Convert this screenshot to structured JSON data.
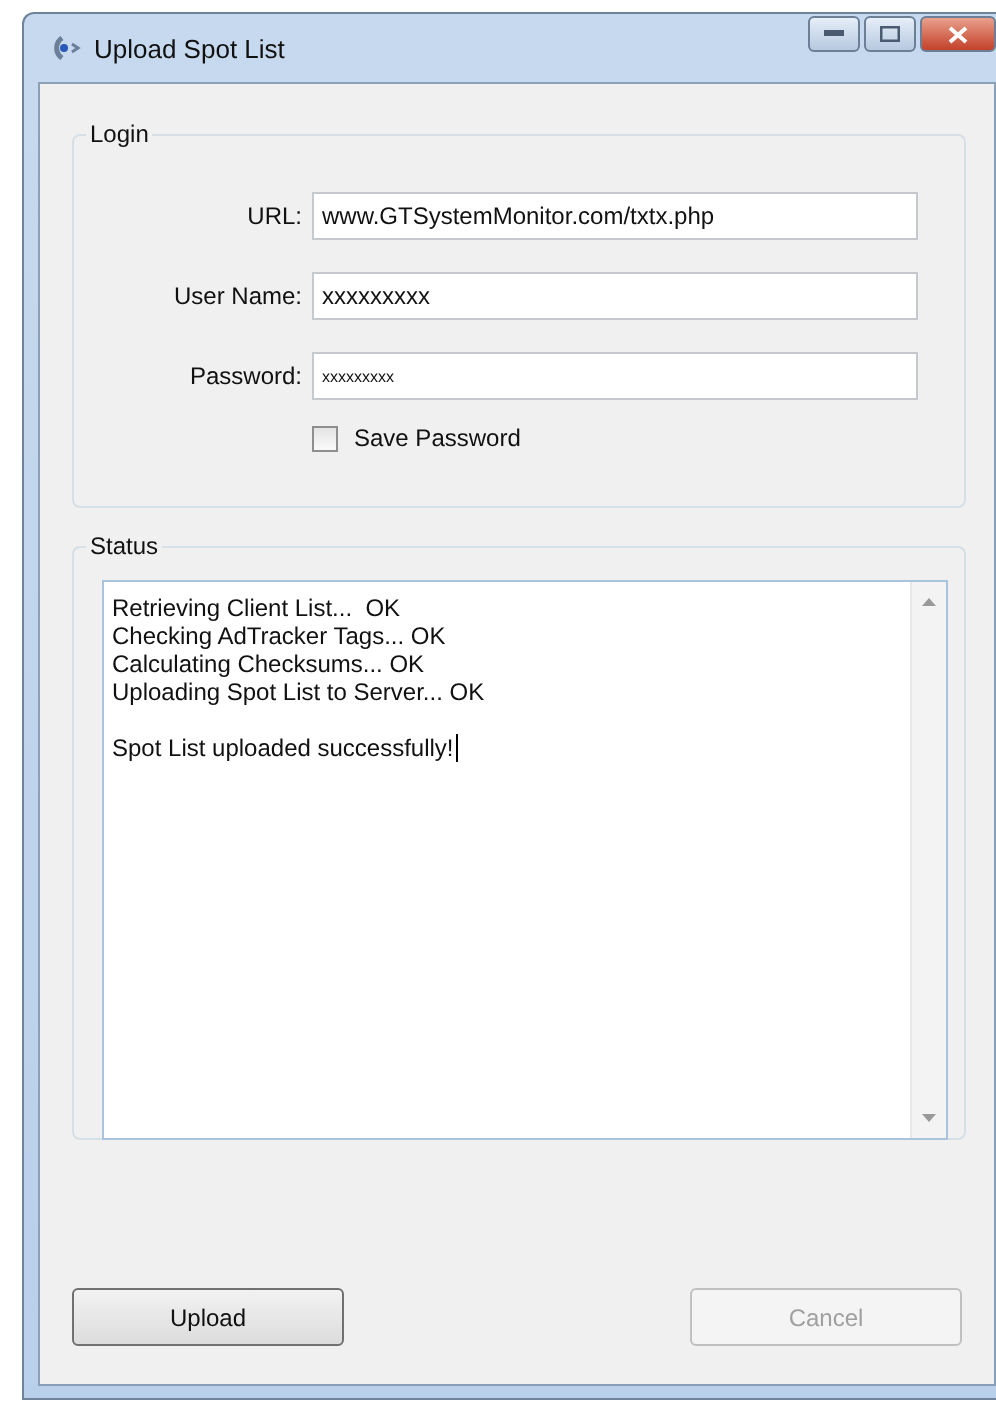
{
  "window": {
    "title": "Upload Spot List"
  },
  "login": {
    "title": "Login",
    "fields": [
      {
        "label": "URL:",
        "value": "www.GTSystemMonitor.com/txtx.php",
        "kind": "text"
      },
      {
        "label": "User Name:",
        "value": "xxxxxxxxx",
        "kind": "text"
      },
      {
        "label": "Password:",
        "value": "xxxxxxxxx",
        "kind": "password"
      }
    ],
    "save_password": {
      "label": "Save Password",
      "checked": false
    }
  },
  "status": {
    "title": "Status",
    "log": [
      "Retrieving Client List...  OK",
      "Checking AdTracker Tags... OK",
      "Calculating Checksums... OK",
      "Uploading Spot List to Server... OK"
    ],
    "result": "Spot List uploaded successfully!"
  },
  "buttons": [
    {
      "label": "Upload",
      "disabled": false
    },
    {
      "label": "Cancel",
      "disabled": true
    }
  ]
}
